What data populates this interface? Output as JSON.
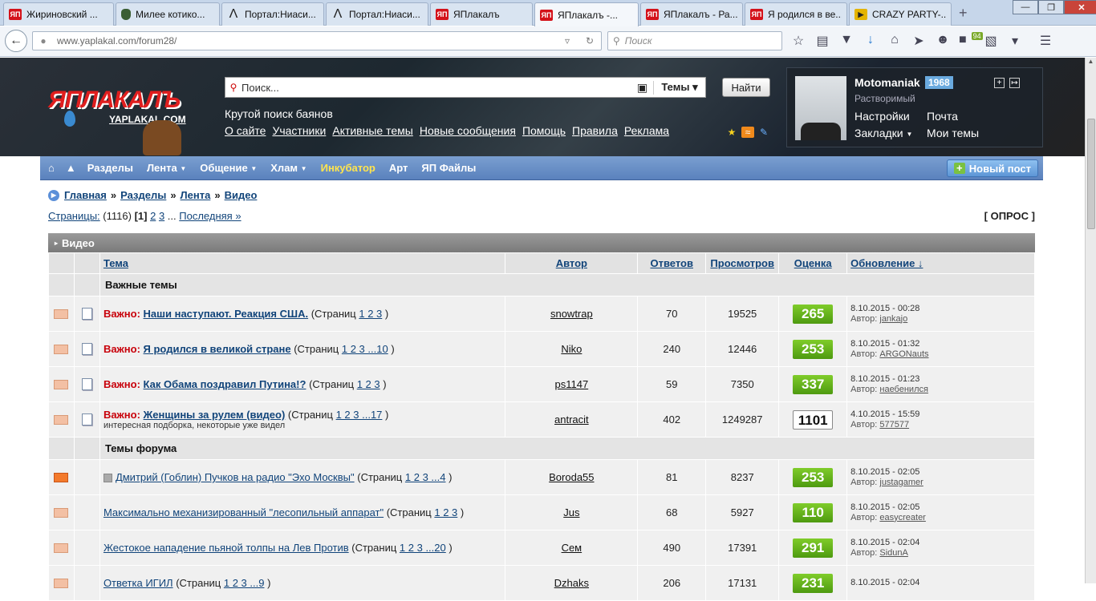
{
  "tabs": [
    {
      "label": "Жириновский ...",
      "icon": "yap"
    },
    {
      "label": "Милее котико...",
      "icon": "shield"
    },
    {
      "label": "Портал:Ниаси...",
      "icon": "lambda"
    },
    {
      "label": "Портал:Ниаси...",
      "icon": "lambda"
    },
    {
      "label": "ЯПлакалъ",
      "icon": "yap"
    },
    {
      "label": "ЯПлакалъ -...",
      "icon": "yap",
      "active": true
    },
    {
      "label": "ЯПлакалъ - Ра...",
      "icon": "yap"
    },
    {
      "label": "Я родился в ве...",
      "icon": "yap"
    },
    {
      "label": "CRAZY PARTY-...",
      "icon": "youtube"
    }
  ],
  "tab_icons": {
    "yap": "ЯП",
    "lambda": "Λ",
    "youtube": "▶",
    "new": "+"
  },
  "window_controls": {
    "min": "—",
    "max": "❐",
    "close": "✕"
  },
  "browser": {
    "url": "www.yaplakal.com/forum28/",
    "search_placeholder": "Поиск",
    "addon_badge": "94"
  },
  "site": {
    "logo": "ЯПЛАКАЛЪ",
    "logo_sub": "YAPLAKAL.COM",
    "search_placeholder": "Поиск...",
    "search_scope": "Темы",
    "find_button": "Найти",
    "tagline": "Крутой поиск баянов",
    "links": [
      "О сайте",
      "Участники",
      "Активные темы",
      "Новые сообщения",
      "Помощь",
      "Правила",
      "Реклама"
    ]
  },
  "user": {
    "name": "Motomaniak",
    "year": "1968",
    "rank": "Растворимый",
    "settings": "Настройки",
    "mail": "Почта",
    "bookmarks": "Закладки",
    "my_topics": "Мои темы"
  },
  "menu": {
    "items": [
      "Разделы",
      "Лента",
      "Общение",
      "Хлам",
      "Инкубатор",
      "Арт",
      "ЯП Файлы"
    ],
    "new_post": "Новый пост"
  },
  "breadcrumb": [
    "Главная",
    "Разделы",
    "Лента",
    "Видео"
  ],
  "pages": {
    "label": "Страницы:",
    "count": "(1116)",
    "current": "[1]",
    "p2": "2",
    "p3": "3",
    "dots": "...",
    "last": "Последняя »"
  },
  "poll": "[ ОПРОС ]",
  "table": {
    "title": "Видео",
    "headers": {
      "topic": "Тема",
      "author": "Автор",
      "replies": "Ответов",
      "views": "Просмотров",
      "rating": "Оценка",
      "updated": "Обновление ↓"
    },
    "section_important": "Важные темы",
    "section_forum": "Темы форума",
    "important_prefix": "Важно:",
    "pages_prefix": "(Страниц",
    "author_prefix": "Автор:",
    "important": [
      {
        "title": "Наши наступают. Реакция США.",
        "pages": "1 2 3",
        "author": "snowtrap",
        "replies": "70",
        "views": "19525",
        "rating": "265",
        "date": "8.10.2015 - 00:28",
        "last": "jankajo"
      },
      {
        "title": "Я родился в великой стране",
        "pages": "1 2 3 ...10",
        "author": "Niko",
        "replies": "240",
        "views": "12446",
        "rating": "253",
        "date": "8.10.2015 - 01:32",
        "last": "ARGONauts"
      },
      {
        "title": "Как Обама поздравил Путина!?",
        "pages": "1 2 3",
        "author": "ps1147",
        "replies": "59",
        "views": "7350",
        "rating": "337",
        "date": "8.10.2015 - 01:23",
        "last": "наебенился"
      },
      {
        "title": "Женщины за рулем (видео)",
        "pages": "1 2 3 ...17",
        "subtitle": "интересная подборка, некоторые уже видел",
        "author": "antracit",
        "replies": "402",
        "views": "1249287",
        "rating": "1101",
        "date": "4.10.2015 - 15:59",
        "last": "577577"
      }
    ],
    "forum": [
      {
        "title": "Дмитрий (Гоблин) Пучков на радио \"Эхо Москвы\"",
        "pages": "1 2 3 ...4",
        "author": "Boroda55",
        "replies": "81",
        "views": "8237",
        "rating": "253",
        "date": "8.10.2015 - 02:05",
        "last": "justagamer"
      },
      {
        "title": "Максимально механизированный \"лесопильный аппарат\"",
        "pages": "1 2 3",
        "author": "Jus",
        "replies": "68",
        "views": "5927",
        "rating": "110",
        "date": "8.10.2015 - 02:05",
        "last": "easycreater"
      },
      {
        "title": "Жестокое нападение пьяной толпы на Лев Против",
        "pages": "1 2 3 ...20",
        "author": "Сем",
        "replies": "490",
        "views": "17391",
        "rating": "291",
        "date": "8.10.2015 - 02:04",
        "last": "SidunA"
      },
      {
        "title": "Ответка ИГИЛ",
        "pages": "1 2 3 ...9",
        "author": "Dzhaks",
        "replies": "206",
        "views": "17131",
        "rating": "231",
        "date": "8.10.2015 - 02:04",
        "last": ""
      }
    ]
  }
}
